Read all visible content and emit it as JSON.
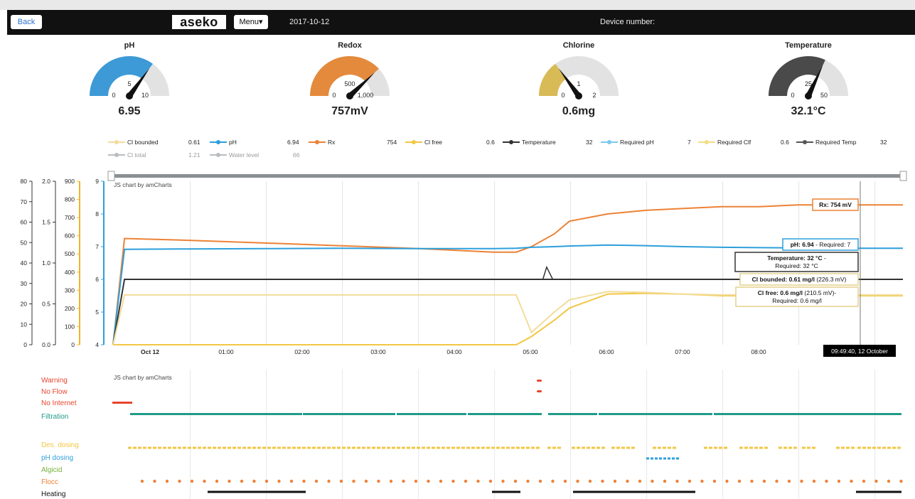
{
  "nav": {
    "back_label": "Back",
    "logo_text": "aseko",
    "menu_label": "Menu▾",
    "date": "2017-10-12",
    "device_label": "Device number:"
  },
  "gauges": [
    {
      "title": "pH",
      "value": "6.95",
      "min": "0",
      "mid": "5",
      "max": "10",
      "fill_fraction": 0.7,
      "color": "#3d9ad6"
    },
    {
      "title": "Redox",
      "value": "757mV",
      "min": "0",
      "mid": "500",
      "max": "1,000",
      "fill_fraction": 0.76,
      "color": "#e48a3c"
    },
    {
      "title": "Chlorine",
      "value": "0.6mg",
      "min": "0",
      "mid": "1",
      "max": "2",
      "fill_fraction": 0.3,
      "color": "#d8bb57"
    },
    {
      "title": "Temperature",
      "value": "32.1°C",
      "min": "0",
      "mid": "25",
      "max": "50",
      "fill_fraction": 0.64,
      "color": "#4a4a4a"
    }
  ],
  "legend": [
    {
      "name": "Cl bounded",
      "value": "0.61",
      "color": "#f3dc9a",
      "muted": false
    },
    {
      "name": "pH",
      "value": "6.94",
      "color": "#2d9fdc",
      "muted": false
    },
    {
      "name": "Rx",
      "value": "754",
      "color": "#ec8236",
      "muted": false
    },
    {
      "name": "Cl free",
      "value": "0.6",
      "color": "#f2c744",
      "muted": false
    },
    {
      "name": "Temperature",
      "value": "32",
      "color": "#333333",
      "muted": false
    },
    {
      "name": "Required pH",
      "value": "7",
      "color": "#7ec8ec",
      "muted": false
    },
    {
      "name": "Required Clf",
      "value": "0.6",
      "color": "#f4dd86",
      "muted": false
    },
    {
      "name": "Required Temp",
      "value": "32",
      "color": "#555555",
      "muted": false
    },
    {
      "name": "Cl total",
      "value": "1.21",
      "color": "#b9bdbf",
      "muted": true
    },
    {
      "name": "Water level",
      "value": "66",
      "color": "#b9bdbf",
      "muted": true
    }
  ],
  "chart_data": {
    "type": "line",
    "credit": "JS chart by amCharts",
    "x_labels": [
      "Oct 12",
      "01:00",
      "02:00",
      "03:00",
      "04:00",
      "05:00",
      "06:00",
      "07:00",
      "08:00"
    ],
    "cursor_time": "09:49:40, 12 October",
    "axes": [
      {
        "ticks": [
          "0",
          "10",
          "20",
          "30",
          "40",
          "50",
          "60",
          "70",
          "80"
        ],
        "color": "#333333"
      },
      {
        "ticks": [
          "0.0",
          "0.5",
          "1.0",
          "1.5",
          "2.0"
        ],
        "color": "#333333"
      },
      {
        "ticks": [
          "0",
          "100",
          "200",
          "300",
          "400",
          "500",
          "600",
          "700",
          "800",
          "900"
        ],
        "color": "#f2b42c"
      },
      {
        "ticks": [
          "4",
          "5",
          "6",
          "7",
          "8",
          "9"
        ],
        "color": "#2d9fdc"
      }
    ],
    "x_hours": [
      0,
      0.15,
      1,
      2,
      3,
      4,
      5,
      5.3,
      5.5,
      5.8,
      6,
      6.5,
      7,
      7.5,
      8,
      8.5,
      9,
      9.83,
      10.5
    ],
    "series": [
      {
        "name": "Rx",
        "color": "#ec8236",
        "values": [
          0,
          585,
          575,
          560,
          545,
          530,
          510,
          510,
          540,
          610,
          680,
          720,
          740,
          750,
          760,
          760,
          770,
          770,
          770
        ]
      },
      {
        "name": "pH",
        "color": "#2d9fdc",
        "values": [
          4,
          6.92,
          6.93,
          6.94,
          6.95,
          6.94,
          6.94,
          6.95,
          6.98,
          7.0,
          7.02,
          7.05,
          7.03,
          7.0,
          6.98,
          6.97,
          6.96,
          6.95,
          6.95
        ]
      },
      {
        "name": "Temperature",
        "color": "#333333",
        "values": [
          0,
          32,
          32,
          32,
          32,
          32,
          32,
          32,
          32,
          32,
          32,
          32,
          32,
          32,
          32,
          32,
          32,
          32,
          32
        ]
      },
      {
        "name": "Cl free",
        "color": "#f2c744",
        "values": [
          0,
          0,
          0,
          0,
          0,
          0,
          0,
          0,
          0.1,
          0.3,
          0.45,
          0.62,
          0.63,
          0.62,
          0.6,
          0.6,
          0.6,
          0.6,
          0.6
        ]
      },
      {
        "name": "Cl bounded",
        "color": "#f3dc9a",
        "values": [
          0,
          0.61,
          0.61,
          0.61,
          0.61,
          0.61,
          0.61,
          0.61,
          0.15,
          0.4,
          0.55,
          0.65,
          0.64,
          0.62,
          0.61,
          0.61,
          0.61,
          0.61,
          0.61
        ]
      }
    ],
    "balloons": [
      {
        "bold": "Rx: 754 mV",
        "rest": "",
        "color": "#ec8236"
      },
      {
        "bold": "pH: 6.94",
        "rest": " - Required: 7",
        "color": "#2d9fdc"
      },
      {
        "bold": "Temperature: 32 °C",
        "rest": " - Required: 32 °C",
        "color": "#333333"
      },
      {
        "bold": "Cl bounded: 0.61 mg/l",
        "rest": " (226.3 mV)",
        "color": "#e6d08a"
      },
      {
        "bold": "Cl free: 0.6 mg/l",
        "rest": " (210.5 mV)- Required: 0.6 mg/l",
        "color": "#e6d08a"
      }
    ]
  },
  "status": {
    "credit": "JS chart by amCharts",
    "rows": [
      {
        "label": "Warning",
        "color": "#e8452f"
      },
      {
        "label": "No Flow",
        "color": "#e8452f"
      },
      {
        "label": "No Internet",
        "color": "#e8452f"
      },
      {
        "label": "Filtration",
        "color": "#1f9b87"
      },
      {
        "label": "Des. dosing",
        "color": "#f2c744"
      },
      {
        "label": "pH dosing",
        "color": "#2d9fdc"
      },
      {
        "label": "Algicid",
        "color": "#78b13a"
      },
      {
        "label": "Flocc",
        "color": "#ec8236"
      },
      {
        "label": "Heating",
        "color": "#111111"
      }
    ]
  }
}
